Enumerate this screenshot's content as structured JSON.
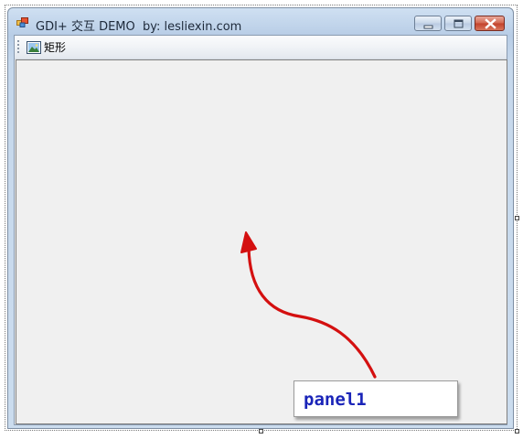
{
  "window": {
    "title": "GDI+ 交互 DEMO  by: lesliexin.com",
    "icon": "app-window-icon"
  },
  "caption_buttons": {
    "minimize": "minimize-icon",
    "maximize": "maximize-icon",
    "close": "close-icon"
  },
  "toolstrip": {
    "items": [
      {
        "label": "矩形",
        "icon": "image-icon"
      }
    ]
  },
  "panel": {
    "annotation_label": "panel1"
  },
  "colors": {
    "arrow": "#d41010",
    "annotation_text": "#1a24b8",
    "close_button": "#c2412a"
  }
}
